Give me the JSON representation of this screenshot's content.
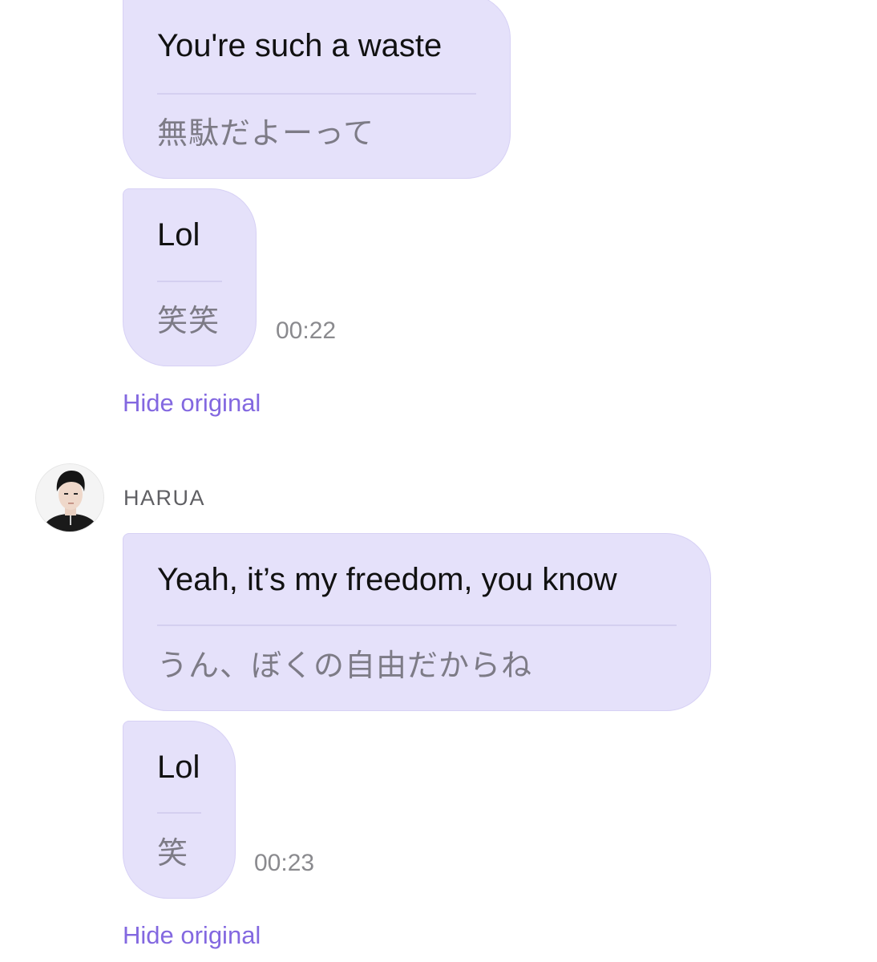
{
  "messages_top": [
    {
      "en": "You're such a waste",
      "jp": "無駄だよーって"
    },
    {
      "en": "Lol",
      "jp": "笑笑",
      "time": "00:22"
    }
  ],
  "hide_original_1": "Hide original",
  "sender": {
    "name": "HARUA",
    "avatar_icon": "profile-photo"
  },
  "messages_bottom": [
    {
      "en": "Yeah, it’s my freedom, you know",
      "jp": "うん、ぼくの自由だからね"
    },
    {
      "en": "Lol",
      "jp": "笑",
      "time": "00:23"
    }
  ],
  "hide_original_2": "Hide original",
  "colors": {
    "bubble": "#e5e1fa",
    "link": "#8368e0",
    "translation_text": "#7d7b86"
  }
}
